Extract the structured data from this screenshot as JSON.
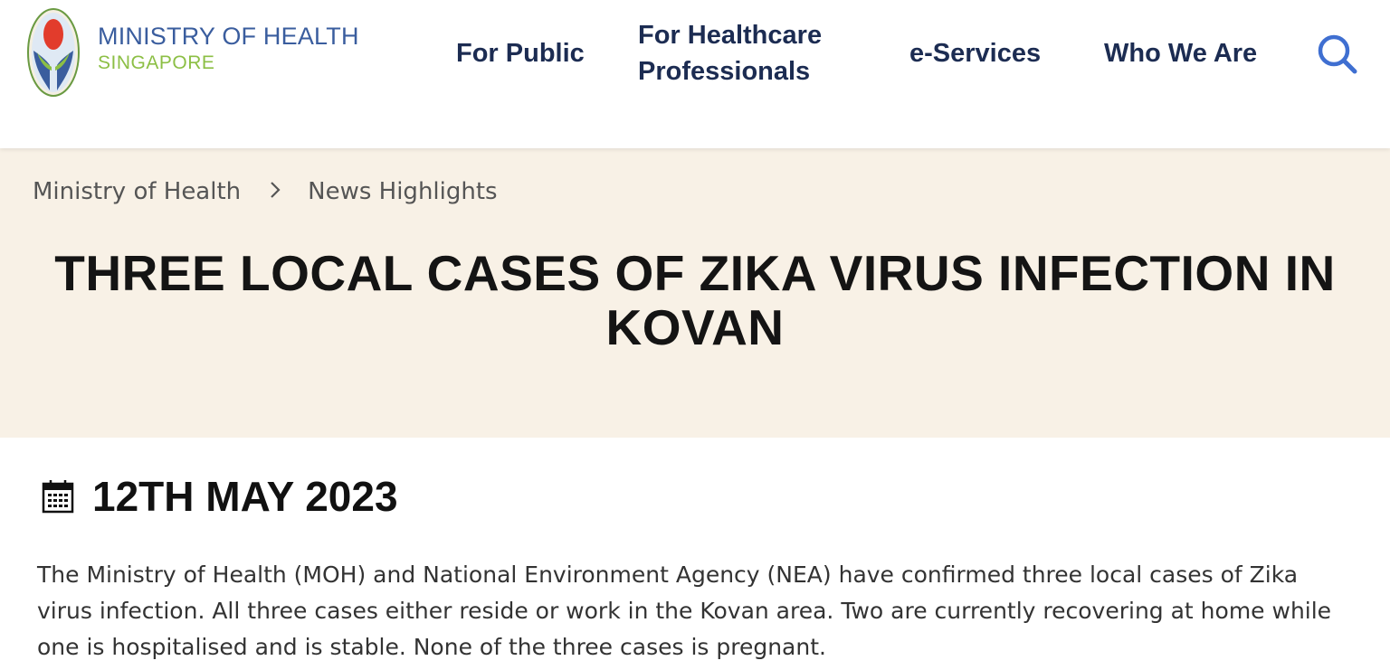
{
  "header": {
    "logo": {
      "line1": "MINISTRY OF HEALTH",
      "line2": "SINGAPORE",
      "emblem_icon": "moh-emblem-icon",
      "colors": {
        "primary": "#3a5d9e",
        "secondary": "#8cbf45"
      }
    },
    "nav": {
      "for_public": "For Public",
      "for_hcp": "For Healthcare Professionals",
      "eservices": "e-Services",
      "who_we_are": "Who We Are"
    },
    "search_icon": "search-icon"
  },
  "hero": {
    "breadcrumb": [
      "Ministry of Health",
      "News Highlights"
    ],
    "title": "THREE LOCAL CASES OF ZIKA VIRUS INFECTION IN KOVAN",
    "background": "#f8f1e6"
  },
  "article": {
    "date_icon": "calendar-icon",
    "date": "12TH MAY 2023",
    "body": "The Ministry of Health (MOH) and National Environment Agency (NEA) have confirmed three local cases of Zika virus infection. All three cases either reside or work in the Kovan area. Two are currently recovering at home while one is hospitalised and is stable. None of the three cases is pregnant."
  }
}
